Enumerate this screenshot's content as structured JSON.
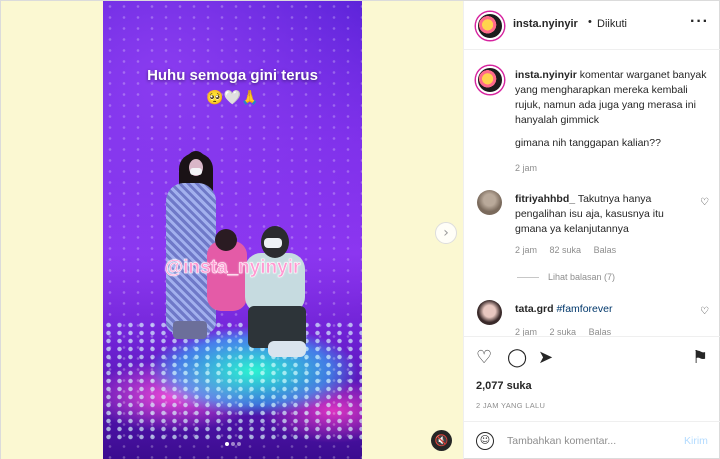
{
  "post": {
    "username": "insta.nyinyir",
    "separator": "•",
    "follow_status": "Diikuti",
    "more_icon": "more-horizontal-icon"
  },
  "media": {
    "overlay_caption": "Huhu semoga gini terus",
    "overlay_emoji": "🥺",
    "overlay_heart": "🤍",
    "overlay_pray": "🙏",
    "watermark": "@insta_nyinyir",
    "slide_index": 1,
    "slide_count": 3,
    "next_icon": "›",
    "mute_icon": "🔇"
  },
  "caption": {
    "username": "insta.nyinyir",
    "text": "komentar warganet banyak yang mengharapkan mereka kembali rujuk, namun ada juga yang merasa ini hanyalah gimmick",
    "question": "gimana nih tanggapan kalian??",
    "time": "2 jam"
  },
  "comments": [
    {
      "username": "fitriyahhbd_",
      "text": "Takutnya hanya pengalihan isu aja, kasusnya itu gmana ya kelanjutannya",
      "time": "2 jam",
      "likes": "82 suka",
      "reply": "Balas",
      "view_replies": "Lihat balasan (7)"
    },
    {
      "username": "tata.grd",
      "text": "#famforever",
      "time": "2 jam",
      "likes": "2 suka",
      "reply": "Balas"
    }
  ],
  "actions": {
    "like_icon": "♡",
    "comment_icon": "◯",
    "share_icon": "➤",
    "save_icon": "⚑",
    "likes_count": "2,077 suka",
    "posted_ago": "2 JAM YANG LALU"
  },
  "composer": {
    "emoji_icon": "☺",
    "placeholder": "Tambahkan komentar...",
    "post_label": "Kirim"
  }
}
